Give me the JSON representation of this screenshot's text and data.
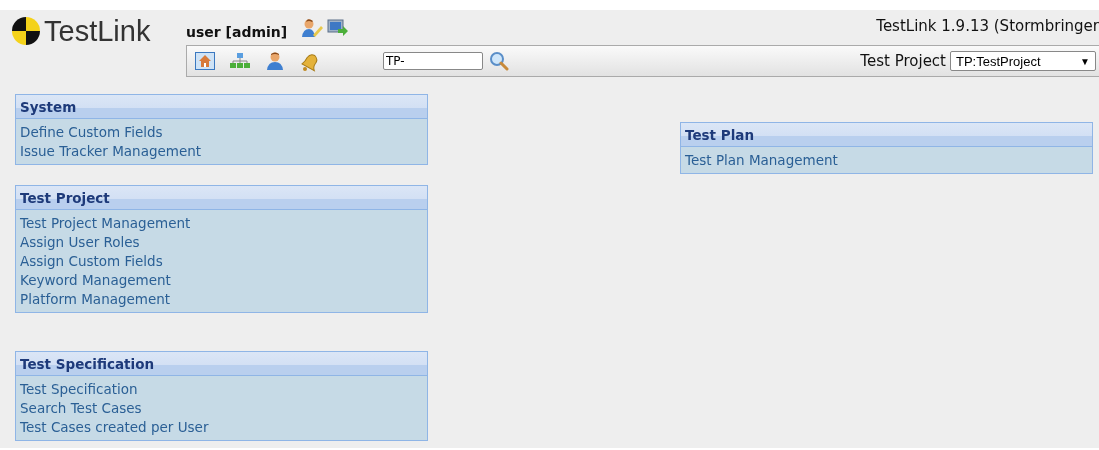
{
  "header": {
    "logo": "TestLink",
    "user": "user [admin]",
    "version": "TestLink 1.9.13 (Stormbringer"
  },
  "toolbar": {
    "search": {
      "value": "TP-"
    },
    "project_label": "Test Project",
    "project_select": "TP:TestProject",
    "project_select_caret": "▼"
  },
  "left_panels": [
    {
      "title": "System",
      "links": [
        "Define Custom Fields",
        "Issue Tracker Management"
      ]
    },
    {
      "title": "Test Project",
      "links": [
        "Test Project Management",
        "Assign User Roles",
        "Assign Custom Fields",
        "Keyword Management",
        "Platform Management"
      ]
    },
    {
      "title": "Test Specification",
      "links": [
        "Test Specification",
        "Search Test Cases",
        "Test Cases created per User"
      ]
    }
  ],
  "right_panels": [
    {
      "title": "Test Plan",
      "links": [
        "Test Plan Management"
      ]
    }
  ]
}
